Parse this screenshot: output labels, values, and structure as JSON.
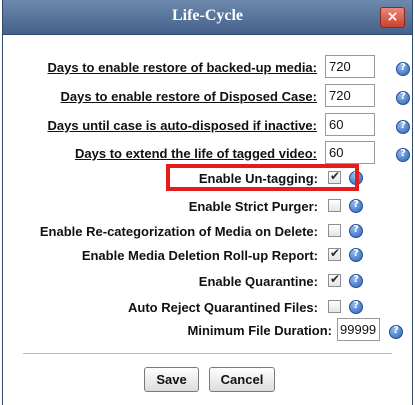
{
  "dialog": {
    "title": "Life-Cycle",
    "close_glyph": "×"
  },
  "settings": [
    {
      "label": "Days to enable restore of backed-up media:",
      "value": "720"
    },
    {
      "label": "Days to enable restore of Disposed Case:",
      "value": "720"
    },
    {
      "label": "Days until case is auto-disposed if inactive:",
      "value": "60"
    },
    {
      "label": "Days to extend the life of tagged video:",
      "value": "60"
    },
    {
      "label": "Enable Un-tagging:",
      "checked": true
    },
    {
      "label": "Enable Strict Purger:",
      "checked": false
    },
    {
      "label": "Enable Re-categorization of Media on Delete:",
      "checked": false
    },
    {
      "label": "Enable Media Deletion Roll-up Report:",
      "checked": true
    },
    {
      "label": "Enable Quarantine:",
      "checked": true
    },
    {
      "label": "Auto Reject Quarantined Files:",
      "checked": false
    },
    {
      "label": "Minimum File Duration:",
      "value": "99999"
    }
  ],
  "icons": {
    "help": "help-icon",
    "help_glyph": "?",
    "check_glyph": "✔"
  },
  "colors": {
    "title_bar": "#4f6d96",
    "highlight": "#e31d1d",
    "help": "#2d62b3"
  },
  "buttons": {
    "save_label": "Save",
    "cancel_label": "Cancel"
  }
}
